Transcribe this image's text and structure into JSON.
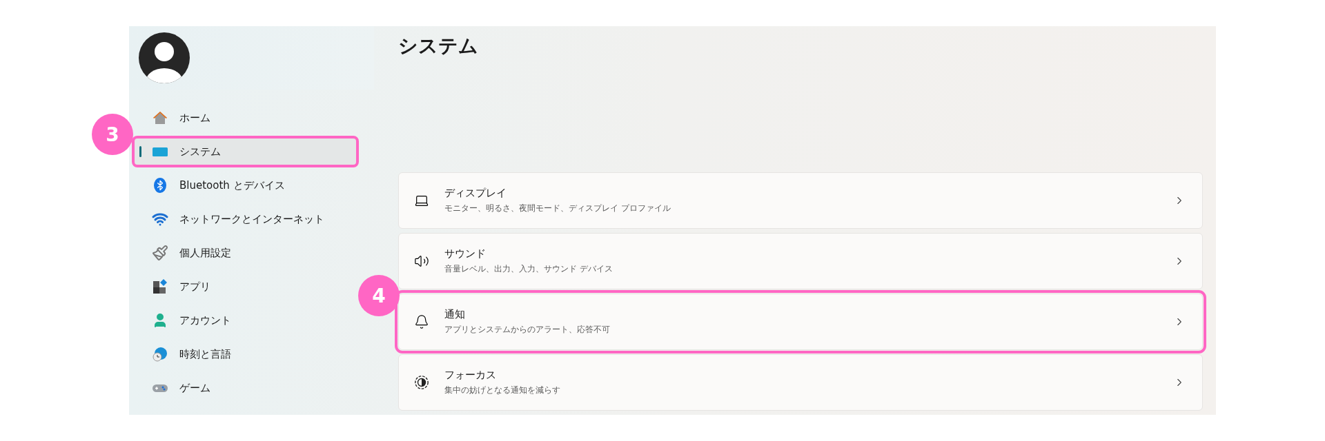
{
  "page_title": "システム",
  "nav_items": [
    {
      "label": "ホーム",
      "selected": false
    },
    {
      "label": "システム",
      "selected": true,
      "callout": "3"
    },
    {
      "label": "Bluetooth とデバイス",
      "selected": false
    },
    {
      "label": "ネットワークとインターネット",
      "selected": false
    },
    {
      "label": "個人用設定",
      "selected": false
    },
    {
      "label": "アプリ",
      "selected": false
    },
    {
      "label": "アカウント",
      "selected": false
    },
    {
      "label": "時刻と言語",
      "selected": false
    },
    {
      "label": "ゲーム",
      "selected": false
    }
  ],
  "cards": [
    {
      "title": "ディスプレイ",
      "subtitle": "モニター、明るさ、夜間モード、ディスプレイ プロファイル"
    },
    {
      "title": "サウンド",
      "subtitle": "音量レベル、出力、入力、サウンド デバイス"
    },
    {
      "title": "通知",
      "subtitle": "アプリとシステムからのアラート、応答不可",
      "callout": "4"
    },
    {
      "title": "フォーカス",
      "subtitle": "集中の妨げとなる通知を減らす"
    }
  ]
}
